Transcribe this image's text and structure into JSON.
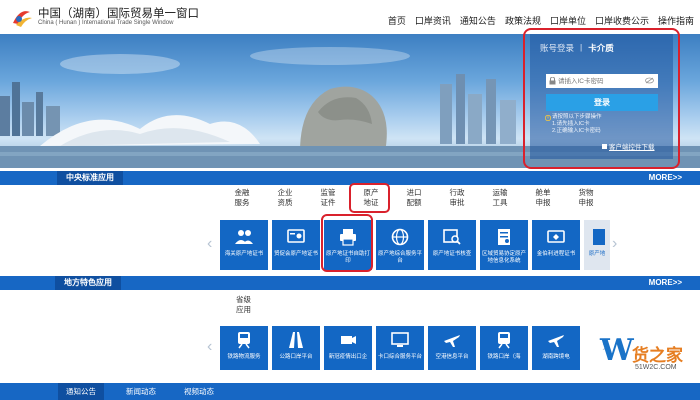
{
  "header": {
    "title_cn": "中国（湖南）国际贸易单一窗口",
    "title_en": "China ( Hunan ) International Trade Single Window",
    "nav": [
      "首页",
      "口岸资讯",
      "通知公告",
      "政策法规",
      "口岸单位",
      "口岸收费公示",
      "操作指南"
    ]
  },
  "login": {
    "tabs": [
      "账号登录",
      "卡介质"
    ],
    "input_placeholder": "请插入IC卡密码",
    "button": "登录",
    "tips": [
      "请按照以下步骤操作",
      "1.请先插入IC卡",
      "2.正确输入IC卡密码"
    ],
    "download": "客户端控件下载"
  },
  "central": {
    "section_title": "中央标准应用",
    "more": "MORE>>",
    "categories": [
      {
        "line1": "金融",
        "line2": "服务"
      },
      {
        "line1": "企业",
        "line2": "资质"
      },
      {
        "line1": "监管",
        "line2": "证件"
      },
      {
        "line1": "原产",
        "line2": "地证"
      },
      {
        "line1": "进口",
        "line2": "配额"
      },
      {
        "line1": "行政",
        "line2": "审批"
      },
      {
        "line1": "运输",
        "line2": "工具"
      },
      {
        "line1": "舱单",
        "line2": "申报"
      },
      {
        "line1": "货物",
        "line2": "申报"
      }
    ],
    "tiles": [
      "海关原产地证书",
      "贸促会原产地证书",
      "原产地证书自助打印",
      "原产地综合服务平台",
      "原产地证书核查",
      "区域贸易协定原产地信息化系统",
      "金伯利进程证书",
      "原产地"
    ]
  },
  "local": {
    "section_title": "地方特色应用",
    "more": "MORE>>",
    "apply_label_1": "省级",
    "apply_label_2": "应用",
    "tiles": [
      "铁路物流服务",
      "公路口岸平台",
      "新冠疫情出口企",
      "卡口综合服务平台",
      "空港信息平台",
      "铁路口岸（海",
      "湖南跨境电"
    ]
  },
  "watermark": {
    "letter": "W",
    "text": "货之家",
    "url": "51W2C.COM"
  },
  "news_tabs": [
    "通知公告",
    "新闻动态",
    "视频动态"
  ],
  "colors": {
    "primary": "#1367c4",
    "highlight": "#d9212c",
    "login_button": "#2aa0e6"
  }
}
